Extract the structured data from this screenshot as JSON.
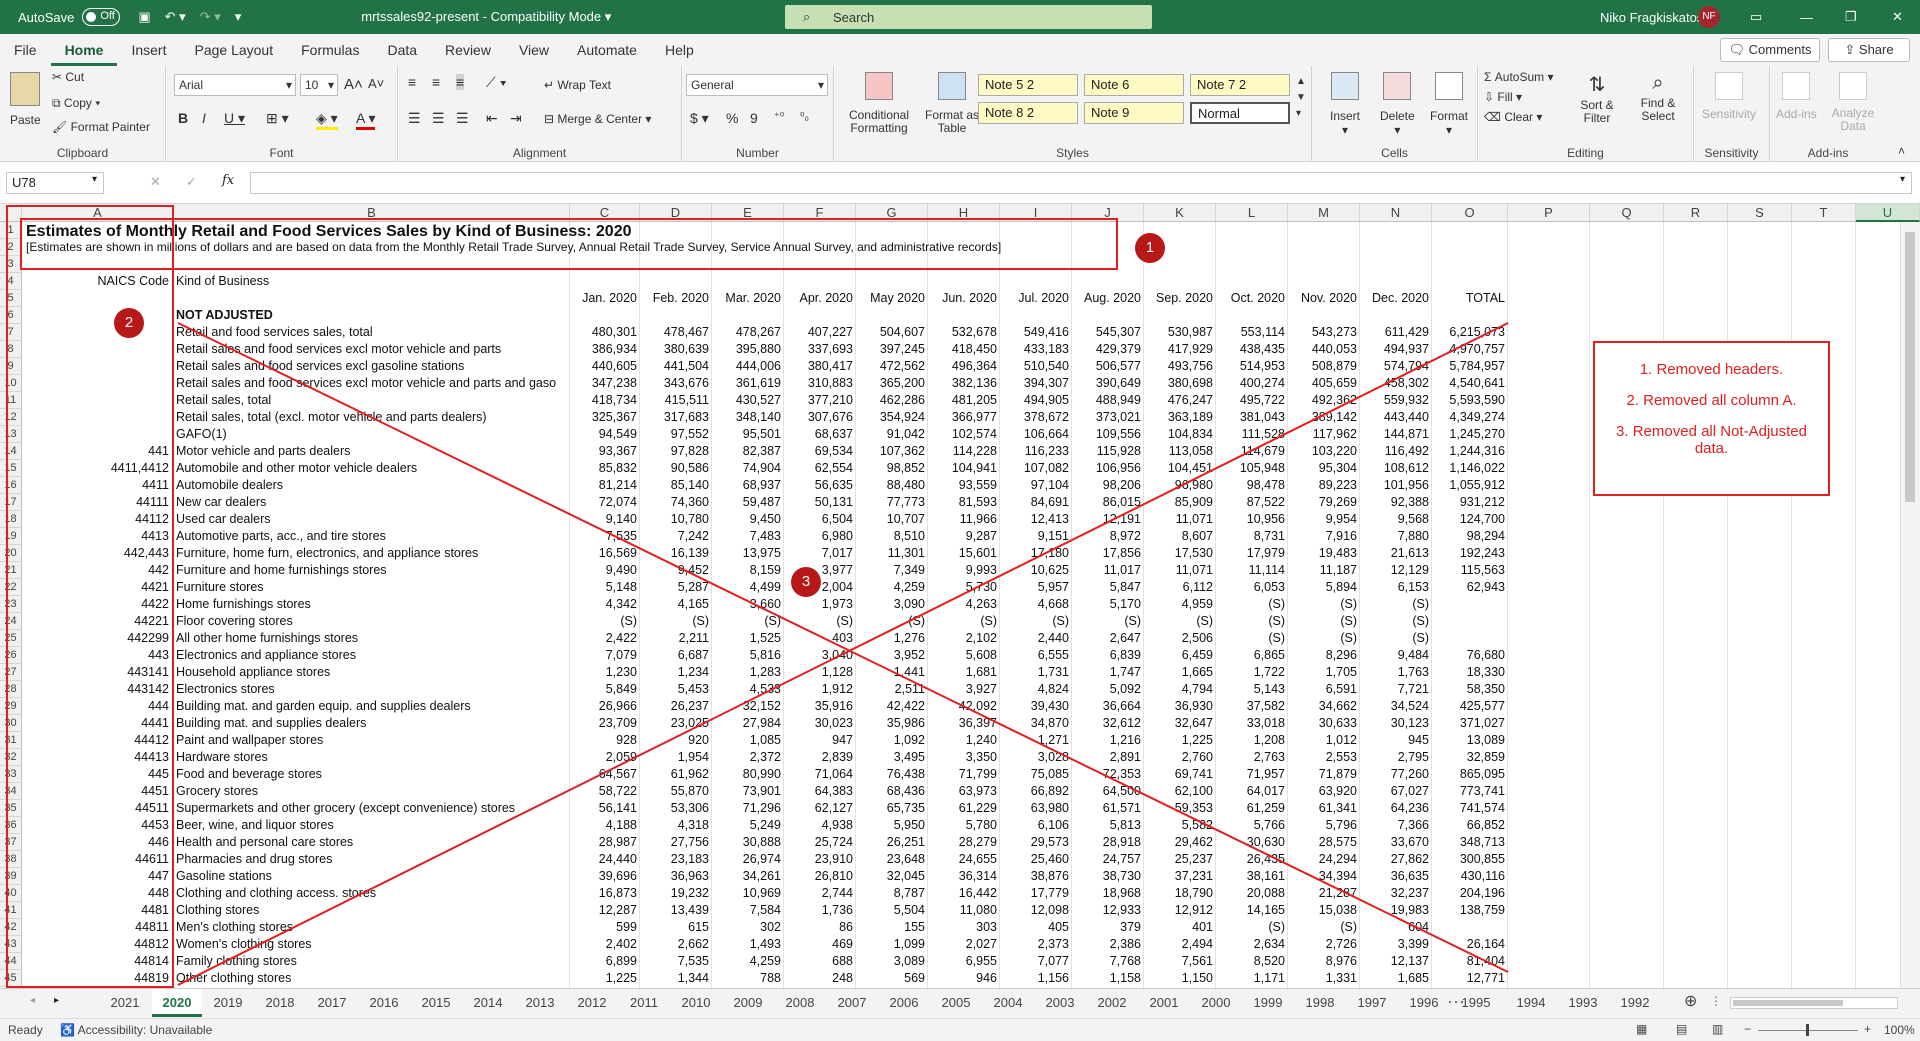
{
  "titlebar": {
    "autosave": "AutoSave",
    "autosave_state": "Off",
    "filename": "mrtssales92-present  -  Compatibility Mode",
    "search_placeholder": "Search",
    "user": "Niko Fragkiskatos",
    "initials": "NF"
  },
  "menu": [
    "File",
    "Home",
    "Insert",
    "Page Layout",
    "Formulas",
    "Data",
    "Review",
    "View",
    "Automate",
    "Help"
  ],
  "menu_right": {
    "comments": "Comments",
    "share": "Share"
  },
  "ribbon": {
    "clipboard": {
      "paste": "Paste",
      "cut": "Cut",
      "copy": "Copy",
      "format_painter": "Format Painter",
      "label": "Clipboard"
    },
    "font": {
      "name": "Arial",
      "size": "10",
      "label": "Font"
    },
    "alignment": {
      "wrap": "Wrap Text",
      "merge": "Merge & Center",
      "label": "Alignment"
    },
    "number": {
      "format": "General",
      "label": "Number"
    },
    "styles": {
      "cond": "Conditional Formatting",
      "table": "Format as Table",
      "label": "Styles",
      "boxes": [
        "Note 5 2",
        "Note 6",
        "Note 7 2",
        "Note 8 2",
        "Note 9",
        "Normal"
      ]
    },
    "cells": {
      "insert": "Insert",
      "delete": "Delete",
      "format": "Format",
      "label": "Cells"
    },
    "editing": {
      "autosum": "AutoSum",
      "fill": "Fill",
      "clear": "Clear",
      "sort": "Sort & Filter",
      "find": "Find & Select",
      "label": "Editing"
    },
    "sensitivity": {
      "btn": "Sensitivity",
      "label": "Sensitivity"
    },
    "addins": {
      "btn": "Add-ins",
      "analyze": "Analyze Data",
      "label": "Add-ins"
    }
  },
  "namebox": "U78",
  "columns": [
    "A",
    "B",
    "C",
    "D",
    "E",
    "F",
    "G",
    "H",
    "I",
    "J",
    "K",
    "L",
    "M",
    "N",
    "O",
    "P",
    "Q",
    "R",
    "S",
    "T",
    "U"
  ],
  "title": "Estimates of Monthly Retail and Food Services Sales by Kind of Business: 2020",
  "subtitle": "[Estimates are shown in millions of dollars and are based on data from the Monthly Retail Trade Survey, Annual Retail Trade Survey, Service Annual Survey, and administrative records]",
  "header": {
    "naics": "NAICS  Code",
    "kind": "Kind of Business",
    "months": [
      "Jan. 2020",
      "Feb. 2020",
      "Mar. 2020",
      "Apr. 2020",
      "May 2020",
      "Jun. 2020",
      "Jul. 2020",
      "Aug. 2020",
      "Sep. 2020",
      "Oct. 2020",
      "Nov. 2020",
      "Dec. 2020",
      "TOTAL"
    ]
  },
  "section": "NOT ADJUSTED",
  "rows": [
    [
      "",
      "Retail and food services sales, total",
      "480,301",
      "478,467",
      "478,267",
      "407,227",
      "504,607",
      "532,678",
      "549,416",
      "545,307",
      "530,987",
      "553,114",
      "543,273",
      "611,429",
      "6,215,073"
    ],
    [
      "",
      "Retail sales and food services excl motor vehicle and parts",
      "386,934",
      "380,639",
      "395,880",
      "337,693",
      "397,245",
      "418,450",
      "433,183",
      "429,379",
      "417,929",
      "438,435",
      "440,053",
      "494,937",
      "4,970,757"
    ],
    [
      "",
      "Retail sales and food services excl gasoline stations",
      "440,605",
      "441,504",
      "444,006",
      "380,417",
      "472,562",
      "496,364",
      "510,540",
      "506,577",
      "493,756",
      "514,953",
      "508,879",
      "574,794",
      "5,784,957"
    ],
    [
      "",
      "Retail sales and food services excl motor vehicle and parts and gaso",
      "347,238",
      "343,676",
      "361,619",
      "310,883",
      "365,200",
      "382,136",
      "394,307",
      "390,649",
      "380,698",
      "400,274",
      "405,659",
      "458,302",
      "4,540,641"
    ],
    [
      "",
      "Retail sales, total",
      "418,734",
      "415,511",
      "430,527",
      "377,210",
      "462,286",
      "481,205",
      "494,905",
      "488,949",
      "476,247",
      "495,722",
      "492,362",
      "559,932",
      "5,593,590"
    ],
    [
      "",
      "Retail sales, total (excl. motor vehicle and parts dealers)",
      "325,367",
      "317,683",
      "348,140",
      "307,676",
      "354,924",
      "366,977",
      "378,672",
      "373,021",
      "363,189",
      "381,043",
      "389,142",
      "443,440",
      "4,349,274"
    ],
    [
      "",
      "GAFO(1)",
      "94,549",
      "97,552",
      "95,501",
      "68,637",
      "91,042",
      "102,574",
      "106,664",
      "109,556",
      "104,834",
      "111,528",
      "117,962",
      "144,871",
      "1,245,270"
    ],
    [
      "441",
      "Motor vehicle and parts dealers",
      "93,367",
      "97,828",
      "82,387",
      "69,534",
      "107,362",
      "114,228",
      "116,233",
      "115,928",
      "113,058",
      "114,679",
      "103,220",
      "116,492",
      "1,244,316"
    ],
    [
      "4411,4412",
      "Automobile and other motor vehicle dealers",
      "85,832",
      "90,586",
      "74,904",
      "62,554",
      "98,852",
      "104,941",
      "107,082",
      "106,956",
      "104,451",
      "105,948",
      "95,304",
      "108,612",
      "1,146,022"
    ],
    [
      "4411",
      "Automobile dealers",
      "81,214",
      "85,140",
      "68,937",
      "56,635",
      "88,480",
      "93,559",
      "97,104",
      "98,206",
      "96,980",
      "98,478",
      "89,223",
      "101,956",
      "1,055,912"
    ],
    [
      "44111",
      "New car dealers",
      "72,074",
      "74,360",
      "59,487",
      "50,131",
      "77,773",
      "81,593",
      "84,691",
      "86,015",
      "85,909",
      "87,522",
      "79,269",
      "92,388",
      "931,212"
    ],
    [
      "44112",
      "Used car dealers",
      "9,140",
      "10,780",
      "9,450",
      "6,504",
      "10,707",
      "11,966",
      "12,413",
      "12,191",
      "11,071",
      "10,956",
      "9,954",
      "9,568",
      "124,700"
    ],
    [
      "4413",
      "Automotive parts, acc., and tire stores",
      "7,535",
      "7,242",
      "7,483",
      "6,980",
      "8,510",
      "9,287",
      "9,151",
      "8,972",
      "8,607",
      "8,731",
      "7,916",
      "7,880",
      "98,294"
    ],
    [
      "442,443",
      "Furniture, home furn, electronics, and appliance stores",
      "16,569",
      "16,139",
      "13,975",
      "7,017",
      "11,301",
      "15,601",
      "17,180",
      "17,856",
      "17,530",
      "17,979",
      "19,483",
      "21,613",
      "192,243"
    ],
    [
      "442",
      "Furniture and home furnishings stores",
      "9,490",
      "9,452",
      "8,159",
      "3,977",
      "7,349",
      "9,993",
      "10,625",
      "11,017",
      "11,071",
      "11,114",
      "11,187",
      "12,129",
      "115,563"
    ],
    [
      "4421",
      "Furniture stores",
      "5,148",
      "5,287",
      "4,499",
      "2,004",
      "4,259",
      "5,730",
      "5,957",
      "5,847",
      "6,112",
      "6,053",
      "5,894",
      "6,153",
      "62,943"
    ],
    [
      "4422",
      "Home furnishings stores",
      "4,342",
      "4,165",
      "3,660",
      "1,973",
      "3,090",
      "4,263",
      "4,668",
      "5,170",
      "4,959",
      "(S)",
      "(S)",
      "(S)",
      ""
    ],
    [
      "44221",
      "Floor covering stores",
      "(S)",
      "(S)",
      "(S)",
      "(S)",
      "(S)",
      "(S)",
      "(S)",
      "(S)",
      "(S)",
      "(S)",
      "(S)",
      "(S)",
      ""
    ],
    [
      "442299",
      "All other home furnishings stores",
      "2,422",
      "2,211",
      "1,525",
      "403",
      "1,276",
      "2,102",
      "2,440",
      "2,647",
      "2,506",
      "(S)",
      "(S)",
      "(S)",
      ""
    ],
    [
      "443",
      "Electronics and appliance stores",
      "7,079",
      "6,687",
      "5,816",
      "3,040",
      "3,952",
      "5,608",
      "6,555",
      "6,839",
      "6,459",
      "6,865",
      "8,296",
      "9,484",
      "76,680"
    ],
    [
      "443141",
      "Household appliance stores",
      "1,230",
      "1,234",
      "1,283",
      "1,128",
      "1,441",
      "1,681",
      "1,731",
      "1,747",
      "1,665",
      "1,722",
      "1,705",
      "1,763",
      "18,330"
    ],
    [
      "443142",
      "Electronics stores",
      "5,849",
      "5,453",
      "4,533",
      "1,912",
      "2,511",
      "3,927",
      "4,824",
      "5,092",
      "4,794",
      "5,143",
      "6,591",
      "7,721",
      "58,350"
    ],
    [
      "444",
      "Building mat. and garden equip. and supplies dealers",
      "26,966",
      "26,237",
      "32,152",
      "35,916",
      "42,422",
      "42,092",
      "39,430",
      "36,664",
      "36,930",
      "37,582",
      "34,662",
      "34,524",
      "425,577"
    ],
    [
      "4441",
      "Building mat. and supplies dealers",
      "23,709",
      "23,025",
      "27,984",
      "30,023",
      "35,986",
      "36,397",
      "34,870",
      "32,612",
      "32,647",
      "33,018",
      "30,633",
      "30,123",
      "371,027"
    ],
    [
      "44412",
      "Paint and wallpaper stores",
      "928",
      "920",
      "1,085",
      "947",
      "1,092",
      "1,240",
      "1,271",
      "1,216",
      "1,225",
      "1,208",
      "1,012",
      "945",
      "13,089"
    ],
    [
      "44413",
      "Hardware stores",
      "2,059",
      "1,954",
      "2,372",
      "2,839",
      "3,495",
      "3,350",
      "3,028",
      "2,891",
      "2,760",
      "2,763",
      "2,553",
      "2,795",
      "32,859"
    ],
    [
      "445",
      "Food and beverage stores",
      "64,567",
      "61,962",
      "80,990",
      "71,064",
      "76,438",
      "71,799",
      "75,085",
      "72,353",
      "69,741",
      "71,957",
      "71,879",
      "77,260",
      "865,095"
    ],
    [
      "4451",
      "Grocery stores",
      "58,722",
      "55,870",
      "73,901",
      "64,383",
      "68,436",
      "63,973",
      "66,892",
      "64,500",
      "62,100",
      "64,017",
      "63,920",
      "67,027",
      "773,741"
    ],
    [
      "44511",
      "Supermarkets and other grocery (except convenience) stores",
      "56,141",
      "53,306",
      "71,296",
      "62,127",
      "65,735",
      "61,229",
      "63,980",
      "61,571",
      "59,353",
      "61,259",
      "61,341",
      "64,236",
      "741,574"
    ],
    [
      "4453",
      "Beer, wine, and liquor stores",
      "4,188",
      "4,318",
      "5,249",
      "4,938",
      "5,950",
      "5,780",
      "6,106",
      "5,813",
      "5,582",
      "5,766",
      "5,796",
      "7,366",
      "66,852"
    ],
    [
      "446",
      "Health and personal care stores",
      "28,987",
      "27,756",
      "30,888",
      "25,724",
      "26,251",
      "28,279",
      "29,573",
      "28,918",
      "29,462",
      "30,630",
      "28,575",
      "33,670",
      "348,713"
    ],
    [
      "44611",
      "Pharmacies and drug stores",
      "24,440",
      "23,183",
      "26,974",
      "23,910",
      "23,648",
      "24,655",
      "25,460",
      "24,757",
      "25,237",
      "26,435",
      "24,294",
      "27,862",
      "300,855"
    ],
    [
      "447",
      "Gasoline stations",
      "39,696",
      "36,963",
      "34,261",
      "26,810",
      "32,045",
      "36,314",
      "38,876",
      "38,730",
      "37,231",
      "38,161",
      "34,394",
      "36,635",
      "430,116"
    ],
    [
      "448",
      "Clothing and clothing access. stores",
      "16,873",
      "19,232",
      "10,969",
      "2,744",
      "8,787",
      "16,442",
      "17,779",
      "18,968",
      "18,790",
      "20,088",
      "21,287",
      "32,237",
      "204,196"
    ],
    [
      "4481",
      "Clothing stores",
      "12,287",
      "13,439",
      "7,584",
      "1,736",
      "5,504",
      "11,080",
      "12,098",
      "12,933",
      "12,912",
      "14,165",
      "15,038",
      "19,983",
      "138,759"
    ],
    [
      "44811",
      "Men's clothing stores",
      "599",
      "615",
      "302",
      "86",
      "155",
      "303",
      "405",
      "379",
      "401",
      "(S)",
      "(S)",
      "604",
      ""
    ],
    [
      "44812",
      "Women's clothing stores",
      "2,402",
      "2,662",
      "1,493",
      "469",
      "1,099",
      "2,027",
      "2,373",
      "2,386",
      "2,494",
      "2,634",
      "2,726",
      "3,399",
      "26,164"
    ],
    [
      "44814",
      "Family clothing stores",
      "6,899",
      "7,535",
      "4,259",
      "688",
      "3,089",
      "6,955",
      "7,077",
      "7,768",
      "7,561",
      "8,520",
      "8,976",
      "12,137",
      "81,404"
    ],
    [
      "44819",
      "Other clothing stores",
      "1,225",
      "1,344",
      "788",
      "248",
      "569",
      "946",
      "1,156",
      "1,158",
      "1,150",
      "1,171",
      "1,331",
      "1,685",
      "12,771"
    ]
  ],
  "annotations": {
    "markers": [
      "1",
      "2",
      "3"
    ],
    "notes": [
      "1. Removed headers.",
      "2. Removed all column A.",
      "3. Removed all Not-Adjusted data."
    ]
  },
  "sheets": [
    "2021",
    "2020",
    "2019",
    "2018",
    "2017",
    "2016",
    "2015",
    "2014",
    "2013",
    "2012",
    "2011",
    "2010",
    "2009",
    "2008",
    "2007",
    "2006",
    "2005",
    "2004",
    "2003",
    "2002",
    "2001",
    "2000",
    "1999",
    "1998",
    "1997",
    "1996",
    "1995",
    "1994",
    "1993",
    "1992"
  ],
  "status": {
    "ready": "Ready",
    "accessibility": "Accessibility: Unavailable",
    "zoom": "100%"
  }
}
